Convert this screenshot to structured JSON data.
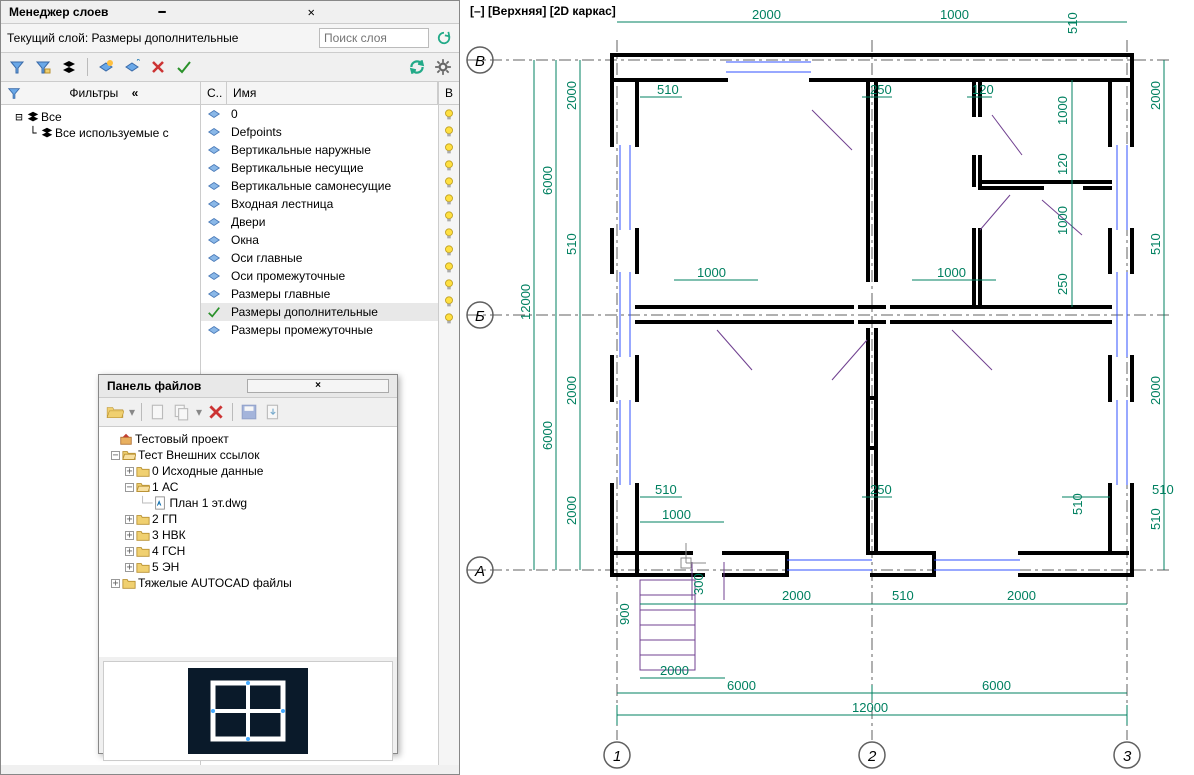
{
  "layer_panel": {
    "title": "Менеджер слоев",
    "current_label": "Текущий слой: Размеры дополнительные",
    "search_placeholder": "Поиск слоя",
    "filters_title": "Фильтры",
    "filter_all": "Все",
    "filter_used": "Все используемые с",
    "col_status": "С..",
    "col_name": "Имя",
    "col_on_title": "В",
    "layers": [
      {
        "name": "0",
        "current": false
      },
      {
        "name": "Defpoints",
        "current": false
      },
      {
        "name": "Вертикальные наружные",
        "current": false
      },
      {
        "name": "Вертикальные несущие",
        "current": false
      },
      {
        "name": "Вертикальные самонесущие",
        "current": false
      },
      {
        "name": "Входная лестница",
        "current": false
      },
      {
        "name": "Двери",
        "current": false
      },
      {
        "name": "Окна",
        "current": false
      },
      {
        "name": "Оси главные",
        "current": false
      },
      {
        "name": "Оси промежуточные",
        "current": false
      },
      {
        "name": "Размеры главные",
        "current": false
      },
      {
        "name": "Размеры дополнительные",
        "current": true
      },
      {
        "name": "Размеры промежуточные",
        "current": false
      }
    ]
  },
  "files_panel": {
    "title": "Панель файлов",
    "project": "Тестовый проект",
    "root": "Тест Внешних ссылок",
    "folders": [
      {
        "name": "0 Исходные данные",
        "expanded": false
      },
      {
        "name": "1 АС",
        "expanded": true,
        "files": [
          "План 1 эт.dwg"
        ]
      },
      {
        "name": "2 ГП",
        "expanded": false
      },
      {
        "name": "3 НВК",
        "expanded": false
      },
      {
        "name": "4 ГСН",
        "expanded": false
      },
      {
        "name": "5 ЭН",
        "expanded": false
      }
    ],
    "heavy": "Тяжелые AUTOCAD файлы"
  },
  "viewport": {
    "label": "[–] [Верхняя] [2D каркас]",
    "axis_rows": [
      "В",
      "Б",
      "А"
    ],
    "axis_cols": [
      "1",
      "2",
      "3"
    ],
    "dims": {
      "h_total": "12000",
      "h_half": "6000",
      "v_total": "12000",
      "v_half": "6000",
      "d2000": "2000",
      "d1000": "1000",
      "d510": "510",
      "d250": "250",
      "d120": "120",
      "d900": "900",
      "d300": "300"
    }
  }
}
